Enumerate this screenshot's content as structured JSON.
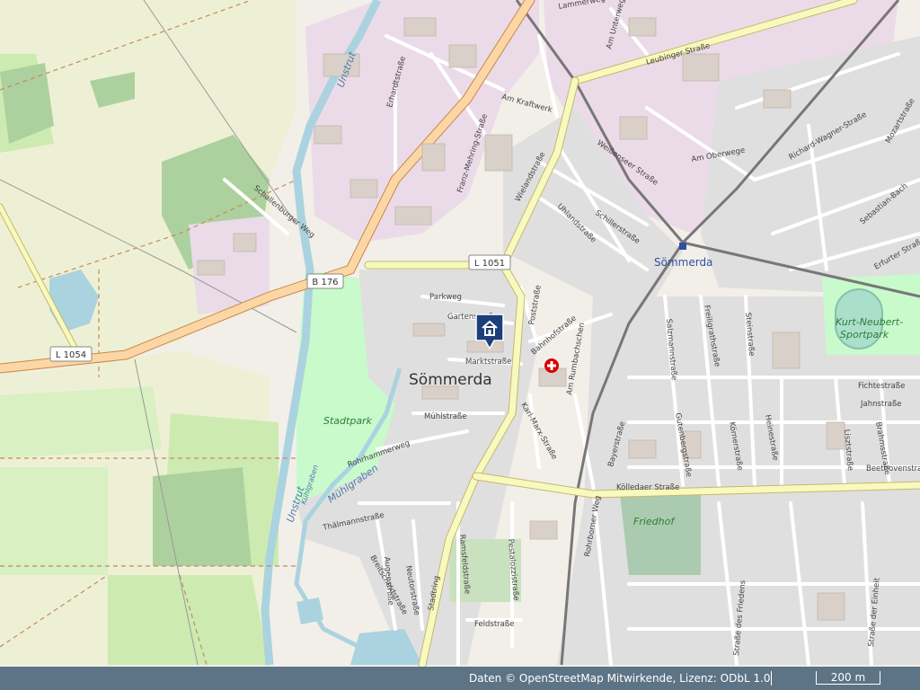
{
  "map": {
    "town_label": "Sömmerda",
    "station_label": "Sömmerda",
    "park_labels": [
      "Stadtpark",
      "Kurt-Neubert-",
      "Sportpark",
      "Friedhof"
    ],
    "water_labels": [
      "Unstrut",
      "Mühlgraben",
      "Kühlgraben",
      "Unstrut"
    ],
    "road_shields": [
      "L 1051",
      "B 176",
      "L 1054"
    ],
    "streets": [
      "Lammerweg",
      "Leubinger Straße",
      "Am Unterwege",
      "Erhardtstraße",
      "Am Kraftwerk",
      "Franz-Mehring-Straße",
      "Wielandstraße",
      "Weißenseer Straße",
      "Schillerstraße",
      "Uhlandstraße",
      "Am Oberwege",
      "Richard-Wagner-Straße",
      "Mozartstraße",
      "Sebastian-Bach",
      "Erfurter Straße",
      "Parkweg",
      "Gartenstraße",
      "Marktstraße",
      "Poststraße",
      "Bahnhofstraße",
      "Salzmannstraße",
      "Freiligrathstraße",
      "Steinstraße",
      "Fichtestraße",
      "Jahnstraße",
      "Mühlstraße",
      "Rohrhammerweg",
      "Karl-Marx-Straße",
      "Am Rumbachschen",
      "Bayerstraße",
      "Gutenbergstraße",
      "Körnerstraße",
      "Heinestraße",
      "Lisztstraße",
      "Brahmsstraße",
      "Beethovenstraße",
      "Kölledaer Straße",
      "Thälmannstraße",
      "Ramsfeldstraße",
      "Pestalozzistraße",
      "Rohrborner Weg",
      "Feldstraße",
      "Stadtring",
      "Breitscheidstraße",
      "Neutorstraße",
      "Straße des Friedens",
      "Straße der Einheit",
      "Schallenburger Weg",
      "Augenstraße"
    ],
    "markers": [
      "home-pin",
      "hospital"
    ]
  },
  "attribution": {
    "text": "Daten © OpenStreetMap Mitwirkende, Lizenz: ODbL 1.0",
    "scale": "200 m"
  },
  "colors": {
    "land": "#f2efe9",
    "residential": "#e0dfdf",
    "industrial": "#ebdbe8",
    "park": "#c8facc",
    "forest": "#add19e",
    "farmland": "#eef0d5",
    "water": "#aad3df",
    "primary_road": "#fcd6a4",
    "secondary_road": "#f7fabf",
    "attribution_bar": "#50697d"
  }
}
